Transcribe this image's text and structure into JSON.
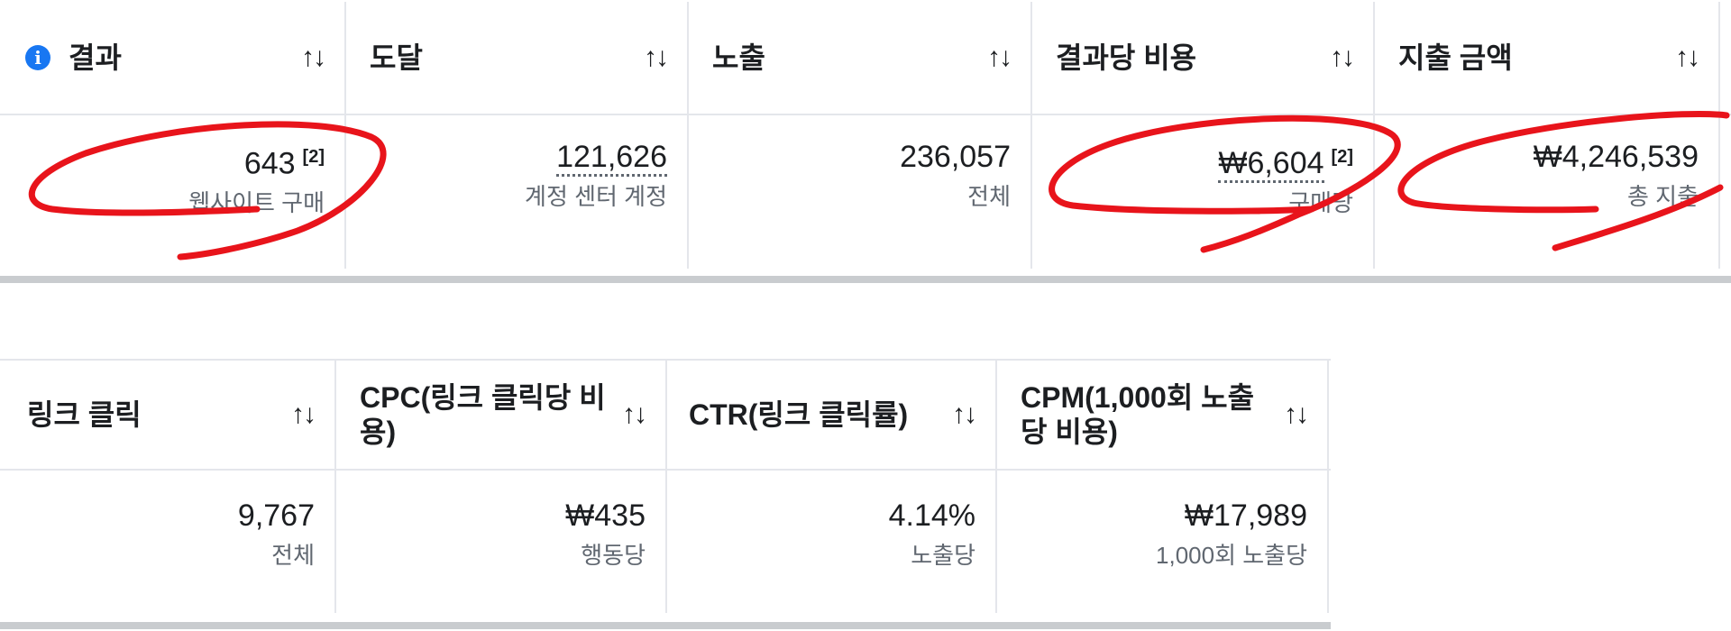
{
  "top_table": {
    "headers": [
      {
        "label": "결과",
        "sort_icon": "↑↓",
        "info_icon": "i"
      },
      {
        "label": "도달",
        "sort_icon": "↑↓"
      },
      {
        "label": "노출",
        "sort_icon": "↑↓"
      },
      {
        "label": "결과당 비용",
        "sort_icon": "↑↓"
      },
      {
        "label": "지출 금액",
        "sort_icon": "↑↓"
      }
    ],
    "row": [
      {
        "value": "643",
        "note": "[2]",
        "sub": "웹사이트 구매"
      },
      {
        "value": "121,626",
        "sub": "계정 센터 계정"
      },
      {
        "value": "236,057",
        "sub": "전체"
      },
      {
        "value": "₩6,604",
        "note": "[2]",
        "sub": "구매당"
      },
      {
        "value": "₩4,246,539",
        "sub": "총 지출"
      }
    ]
  },
  "bottom_table": {
    "headers": [
      {
        "label": "링크 클릭",
        "sort_icon": "↑↓"
      },
      {
        "label": "CPC(링크 클릭당 비용)",
        "sort_icon": "↑↓"
      },
      {
        "label": "CTR(링크 클릭률)",
        "sort_icon": "↑↓"
      },
      {
        "label": "CPM(1,000회 노출당 비용)",
        "sort_icon": "↑↓"
      }
    ],
    "row": [
      {
        "value": "9,767",
        "sub": "전체"
      },
      {
        "value": "₩435",
        "sub": "행동당"
      },
      {
        "value": "4.14%",
        "sub": "노출당"
      },
      {
        "value": "₩17,989",
        "sub": "1,000회 노출당"
      }
    ]
  },
  "annotations": {
    "color": "#e8141b",
    "count": 3
  }
}
